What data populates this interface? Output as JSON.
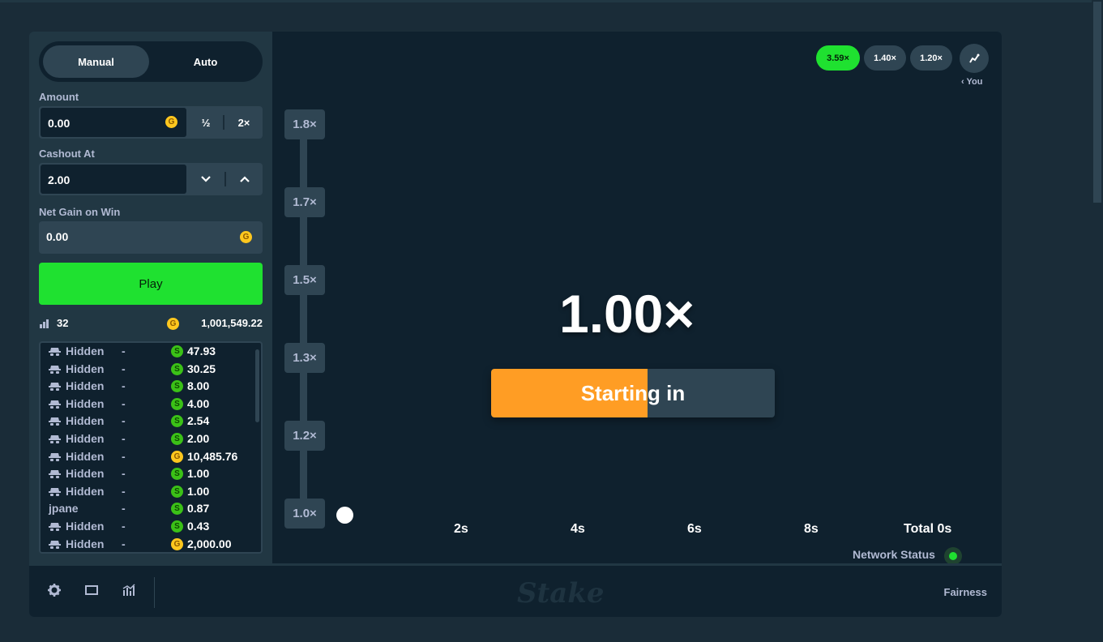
{
  "sidebar": {
    "tabs": [
      {
        "label": "Manual"
      },
      {
        "label": "Auto"
      }
    ],
    "amount": {
      "label": "Amount",
      "value": "0.00",
      "half": "½",
      "double": "2×"
    },
    "cashout": {
      "label": "Cashout At",
      "value": "2.00"
    },
    "netgain": {
      "label": "Net Gain on Win",
      "value": "0.00"
    },
    "play_label": "Play",
    "player_count": "32",
    "total_bet": "1,001,549.22",
    "players": [
      {
        "name": "Hidden",
        "hidden": true,
        "cashout": "-",
        "currency": "S",
        "amount": "47.93"
      },
      {
        "name": "Hidden",
        "hidden": true,
        "cashout": "-",
        "currency": "S",
        "amount": "30.25"
      },
      {
        "name": "Hidden",
        "hidden": true,
        "cashout": "-",
        "currency": "S",
        "amount": "8.00"
      },
      {
        "name": "Hidden",
        "hidden": true,
        "cashout": "-",
        "currency": "S",
        "amount": "4.00"
      },
      {
        "name": "Hidden",
        "hidden": true,
        "cashout": "-",
        "currency": "S",
        "amount": "2.54"
      },
      {
        "name": "Hidden",
        "hidden": true,
        "cashout": "-",
        "currency": "S",
        "amount": "2.00"
      },
      {
        "name": "Hidden",
        "hidden": true,
        "cashout": "-",
        "currency": "G",
        "amount": "10,485.76"
      },
      {
        "name": "Hidden",
        "hidden": true,
        "cashout": "-",
        "currency": "S",
        "amount": "1.00"
      },
      {
        "name": "Hidden",
        "hidden": true,
        "cashout": "-",
        "currency": "S",
        "amount": "1.00"
      },
      {
        "name": "jpane",
        "hidden": false,
        "cashout": "-",
        "currency": "S",
        "amount": "0.87"
      },
      {
        "name": "Hidden",
        "hidden": true,
        "cashout": "-",
        "currency": "S",
        "amount": "0.43"
      },
      {
        "name": "Hidden",
        "hidden": true,
        "cashout": "-",
        "currency": "G",
        "amount": "2,000.00"
      }
    ]
  },
  "game": {
    "history": [
      {
        "label": "3.59×",
        "style": "green"
      },
      {
        "label": "1.40×",
        "style": "grey"
      },
      {
        "label": "1.20×",
        "style": "grey"
      }
    ],
    "you_label": "You",
    "y_labels": [
      "1.8×",
      "1.7×",
      "1.5×",
      "1.3×",
      "1.2×",
      "1.0×"
    ],
    "x_labels": [
      "2s",
      "4s",
      "6s",
      "8s",
      "Total 0s"
    ],
    "multiplier": "1.00×",
    "countdown_label": "Starting in",
    "countdown_progress": 0.55,
    "network_status_label": "Network Status"
  },
  "footer": {
    "brand": "Stake",
    "fairness_label": "Fairness"
  },
  "colors": {
    "accent_green": "#1fe130",
    "accent_orange": "#ff9d24",
    "gold_coin": "#ffc71e",
    "sweeps_coin": "#3bc117"
  }
}
